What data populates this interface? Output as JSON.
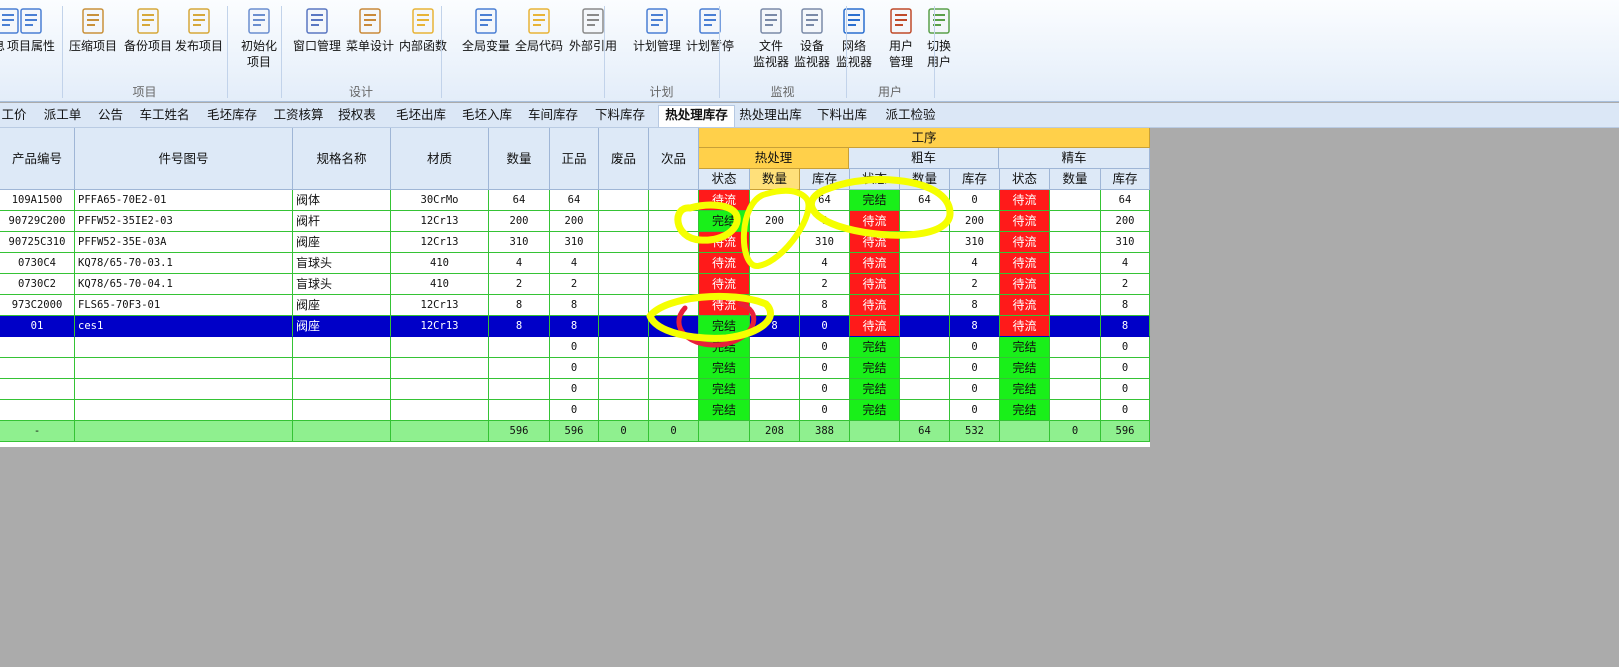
{
  "ribbon": {
    "buttons": [
      {
        "label": "息",
        "name": "info-button",
        "icon": "info-icon"
      },
      {
        "label": "项目属性",
        "name": "project-properties-button",
        "icon": "properties-icon"
      },
      {
        "label": "压缩项目",
        "name": "compress-project-button",
        "icon": "compress-icon"
      },
      {
        "label": "备份项目",
        "name": "backup-project-button",
        "icon": "backup-icon"
      },
      {
        "label": "发布项目",
        "name": "publish-project-button",
        "icon": "publish-icon"
      },
      {
        "label": "初始化\n项目",
        "name": "init-project-button",
        "icon": "init-icon"
      },
      {
        "label": "窗口管理",
        "name": "window-manage-button",
        "icon": "window-icon"
      },
      {
        "label": "菜单设计",
        "name": "menu-design-button",
        "icon": "menu-tools-icon"
      },
      {
        "label": "内部函数",
        "name": "internal-functions-button",
        "icon": "function-icon"
      },
      {
        "label": "全局变量",
        "name": "global-variables-button",
        "icon": "variable-icon"
      },
      {
        "label": "全局代码",
        "name": "global-code-button",
        "icon": "code-icon"
      },
      {
        "label": "外部引用",
        "name": "external-references-button",
        "icon": "books-icon"
      },
      {
        "label": "计划管理",
        "name": "plan-manage-button",
        "icon": "calendar-icon"
      },
      {
        "label": "计划暂停",
        "name": "plan-pause-button",
        "icon": "pause-icon"
      },
      {
        "label": "文件\n监视器",
        "name": "file-monitor-button",
        "icon": "file-monitor-icon"
      },
      {
        "label": "设备\n监视器",
        "name": "device-monitor-button",
        "icon": "device-monitor-icon"
      },
      {
        "label": "网络\n监视器",
        "name": "network-monitor-button",
        "icon": "globe-icon"
      },
      {
        "label": "用户\n管理",
        "name": "user-manage-button",
        "icon": "users-icon"
      },
      {
        "label": "切换\n用户",
        "name": "switch-user-button",
        "icon": "switch-user-icon"
      }
    ],
    "groups": [
      "项目",
      "设计",
      "计划",
      "监视",
      "用户"
    ]
  },
  "tabs": [
    "工价",
    "派工单",
    "公告",
    "车工姓名",
    "毛坯库存",
    "工资核算",
    "授权表",
    "毛坯出库",
    "毛坯入库",
    "车间库存",
    "下料库存",
    "热处理库存",
    "热处理出库",
    "下料出库",
    "派工检验"
  ],
  "active_tab": "热处理库存",
  "grid": {
    "headers": {
      "product_no": "产品编号",
      "part_drawing": "件号图号",
      "spec": "规格名称",
      "material": "材质",
      "qty": "数量",
      "good": "正品",
      "scrap": "废品",
      "defect": "次品",
      "process": "工序",
      "heat": "热处理",
      "rough": "粗车",
      "finish": "精车",
      "status": "状态",
      "count": "数量",
      "stock": "库存"
    },
    "status_words": {
      "pending": "待流",
      "done": "完结"
    },
    "rows": [
      {
        "product_no": "109A1500",
        "part": "PFFA65-70E2-01",
        "spec": "阀体",
        "material": "30CrMo",
        "qty": "64",
        "good": "64",
        "scrap": "",
        "defect": "",
        "h_status": "待流",
        "h_count": "",
        "h_stock": "64",
        "r_status": "完结",
        "r_count": "64",
        "r_stock": "0",
        "f_status": "待流",
        "f_count": "",
        "f_stock": "64"
      },
      {
        "product_no": "90729C200",
        "part": "PFFW52-35IE2-03",
        "spec": "阀杆",
        "material": "12Cr13",
        "qty": "200",
        "good": "200",
        "scrap": "",
        "defect": "",
        "h_status": "完结",
        "h_count": "200",
        "h_stock": "0",
        "r_status": "待流",
        "r_count": "",
        "r_stock": "200",
        "f_status": "待流",
        "f_count": "",
        "f_stock": "200"
      },
      {
        "product_no": "90725C310",
        "part": "PFFW52-35E-03A",
        "spec": "阀座",
        "material": "12Cr13",
        "qty": "310",
        "good": "310",
        "scrap": "",
        "defect": "",
        "h_status": "待流",
        "h_count": "",
        "h_stock": "310",
        "r_status": "待流",
        "r_count": "",
        "r_stock": "310",
        "f_status": "待流",
        "f_count": "",
        "f_stock": "310"
      },
      {
        "product_no": "0730C4",
        "part": "KQ78/65-70-03.1",
        "spec": "盲球头",
        "material": "410",
        "qty": "4",
        "good": "4",
        "scrap": "",
        "defect": "",
        "h_status": "待流",
        "h_count": "",
        "h_stock": "4",
        "r_status": "待流",
        "r_count": "",
        "r_stock": "4",
        "f_status": "待流",
        "f_count": "",
        "f_stock": "4"
      },
      {
        "product_no": "0730C2",
        "part": "KQ78/65-70-04.1",
        "spec": "盲球头",
        "material": "410",
        "qty": "2",
        "good": "2",
        "scrap": "",
        "defect": "",
        "h_status": "待流",
        "h_count": "",
        "h_stock": "2",
        "r_status": "待流",
        "r_count": "",
        "r_stock": "2",
        "f_status": "待流",
        "f_count": "",
        "f_stock": "2"
      },
      {
        "product_no": "973C2000",
        "part": "FLS65-70F3-01",
        "spec": "阀座",
        "material": "12Cr13",
        "qty": "8",
        "good": "8",
        "scrap": "",
        "defect": "",
        "h_status": "待流",
        "h_count": "",
        "h_stock": "8",
        "r_status": "待流",
        "r_count": "",
        "r_stock": "8",
        "f_status": "待流",
        "f_count": "",
        "f_stock": "8"
      },
      {
        "product_no": "01",
        "part": "ces1",
        "spec": "阀座",
        "material": "12Cr13",
        "qty": "8",
        "good": "8",
        "scrap": "",
        "defect": "",
        "h_status": "完结",
        "h_count": "8",
        "h_stock": "0",
        "r_status": "待流",
        "r_count": "",
        "r_stock": "8",
        "f_status": "待流",
        "f_count": "",
        "f_stock": "8",
        "selected": true
      },
      {
        "product_no": "",
        "part": "",
        "spec": "",
        "material": "",
        "qty": "",
        "good": "0",
        "scrap": "",
        "defect": "",
        "h_status": "完结",
        "h_count": "",
        "h_stock": "0",
        "r_status": "完结",
        "r_count": "",
        "r_stock": "0",
        "f_status": "完结",
        "f_count": "",
        "f_stock": "0"
      },
      {
        "product_no": "",
        "part": "",
        "spec": "",
        "material": "",
        "qty": "",
        "good": "0",
        "scrap": "",
        "defect": "",
        "h_status": "完结",
        "h_count": "",
        "h_stock": "0",
        "r_status": "完结",
        "r_count": "",
        "r_stock": "0",
        "f_status": "完结",
        "f_count": "",
        "f_stock": "0"
      },
      {
        "product_no": "",
        "part": "",
        "spec": "",
        "material": "",
        "qty": "",
        "good": "0",
        "scrap": "",
        "defect": "",
        "h_status": "完结",
        "h_count": "",
        "h_stock": "0",
        "r_status": "完结",
        "r_count": "",
        "r_stock": "0",
        "f_status": "完结",
        "f_count": "",
        "f_stock": "0"
      },
      {
        "product_no": "",
        "part": "",
        "spec": "",
        "material": "",
        "qty": "",
        "good": "0",
        "scrap": "",
        "defect": "",
        "h_status": "完结",
        "h_count": "",
        "h_stock": "0",
        "r_status": "完结",
        "r_count": "",
        "r_stock": "0",
        "f_status": "完结",
        "f_count": "",
        "f_stock": "0"
      }
    ],
    "totals": {
      "product_no": "-",
      "part": "",
      "spec": "",
      "material": "",
      "qty": "596",
      "good": "596",
      "scrap": "0",
      "defect": "0",
      "h_status": "",
      "h_count": "208",
      "h_stock": "388",
      "r_status": "",
      "r_count": "64",
      "r_stock": "532",
      "f_status": "",
      "f_count": "0",
      "f_stock": "596"
    }
  },
  "colors": {
    "pending": "#ff1a1a",
    "done": "#19f019",
    "selected_row": "#0000c8",
    "total_row": "#8ff08f",
    "gridline": "#35c335",
    "annotation_yellow": "#f5ff00",
    "annotation_red": "#e8203a"
  }
}
